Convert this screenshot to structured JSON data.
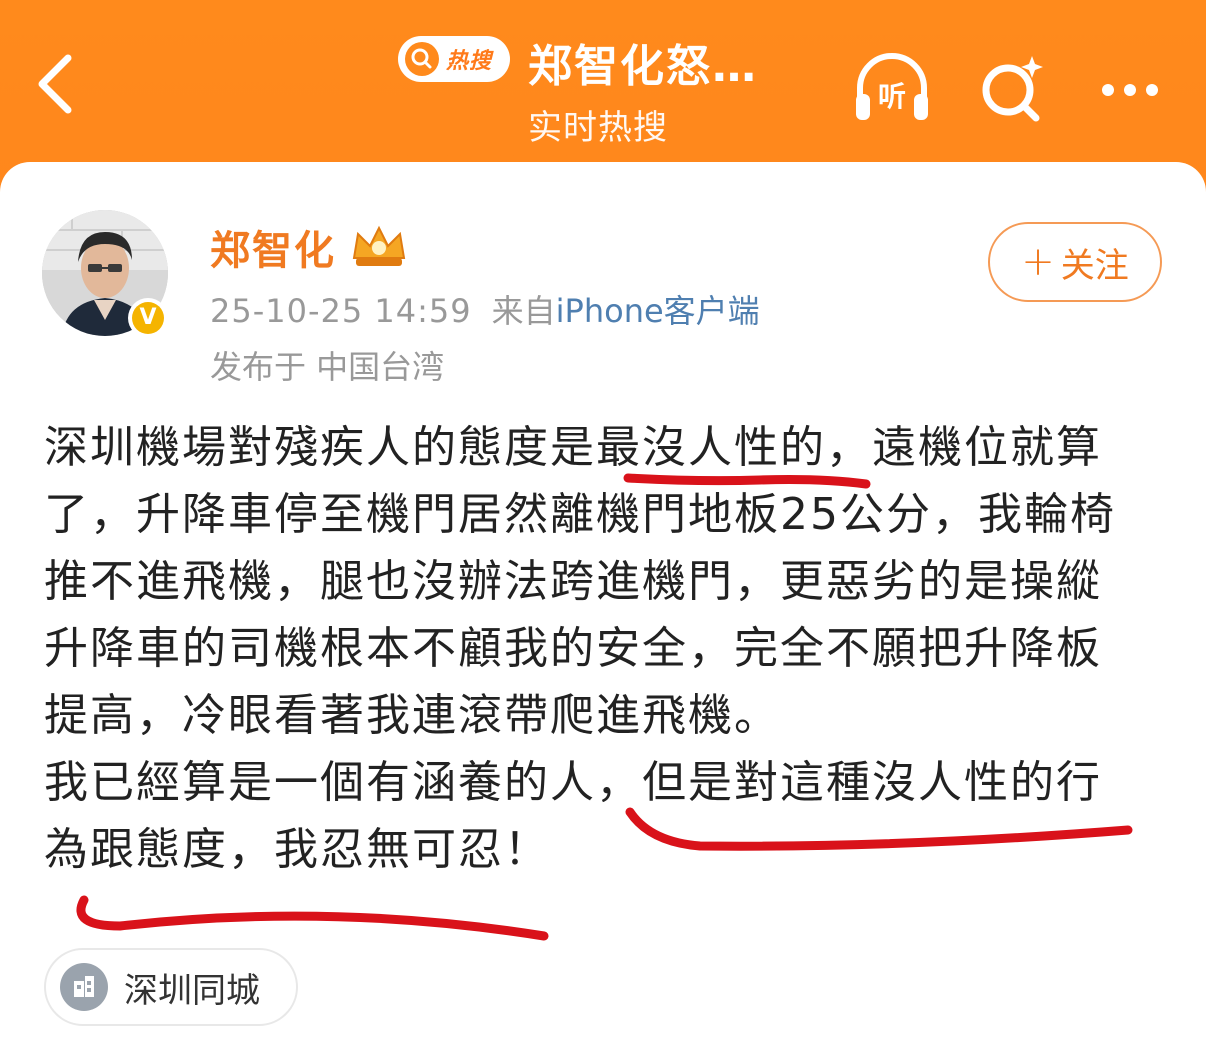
{
  "header": {
    "back_icon": "chevron-left-icon",
    "badge_text": "热搜",
    "title": "郑智化怒…",
    "subtitle": "实时热搜",
    "listen_label": "听",
    "search_icon": "search-sparkle-icon",
    "more_icon": "more-dots-icon",
    "colors": {
      "background": "#ff7a1a",
      "text": "#ffffff"
    }
  },
  "post": {
    "author": {
      "name": "郑智化",
      "avatar": "avatar-photo",
      "verified_badge": "V",
      "member_icon": "crown-icon"
    },
    "timestamp": "25-10-25 14:59",
    "source_prefix": "来自",
    "source_client": "iPhone客户端",
    "location": "发布于 中国台湾",
    "follow_button": {
      "plus": "+",
      "label": "关注"
    },
    "text_lines": [
      "深圳機場對殘疾人的態度是最沒人性的，遠機位就算",
      "了，升降車停至機門居然離機門地板25公分，我輪椅",
      "推不進飛機，腿也沒辦法跨進機門，更惡劣的是操縱",
      "升降車的司機根本不顧我的安全，完全不願把升降板",
      "提高，冷眼看著我連滾帶爬進飛機。",
      "我已經算是一個有涵養的人，但是對這種沒人性的行",
      "為跟態度，我忍無可忍！"
    ],
    "topic_chip": {
      "icon": "building-icon",
      "label": "深圳同城"
    },
    "colors": {
      "accent": "#f07a21",
      "link": "#4f7fb0",
      "meta": "#999999",
      "underline": "#d9121a"
    }
  }
}
